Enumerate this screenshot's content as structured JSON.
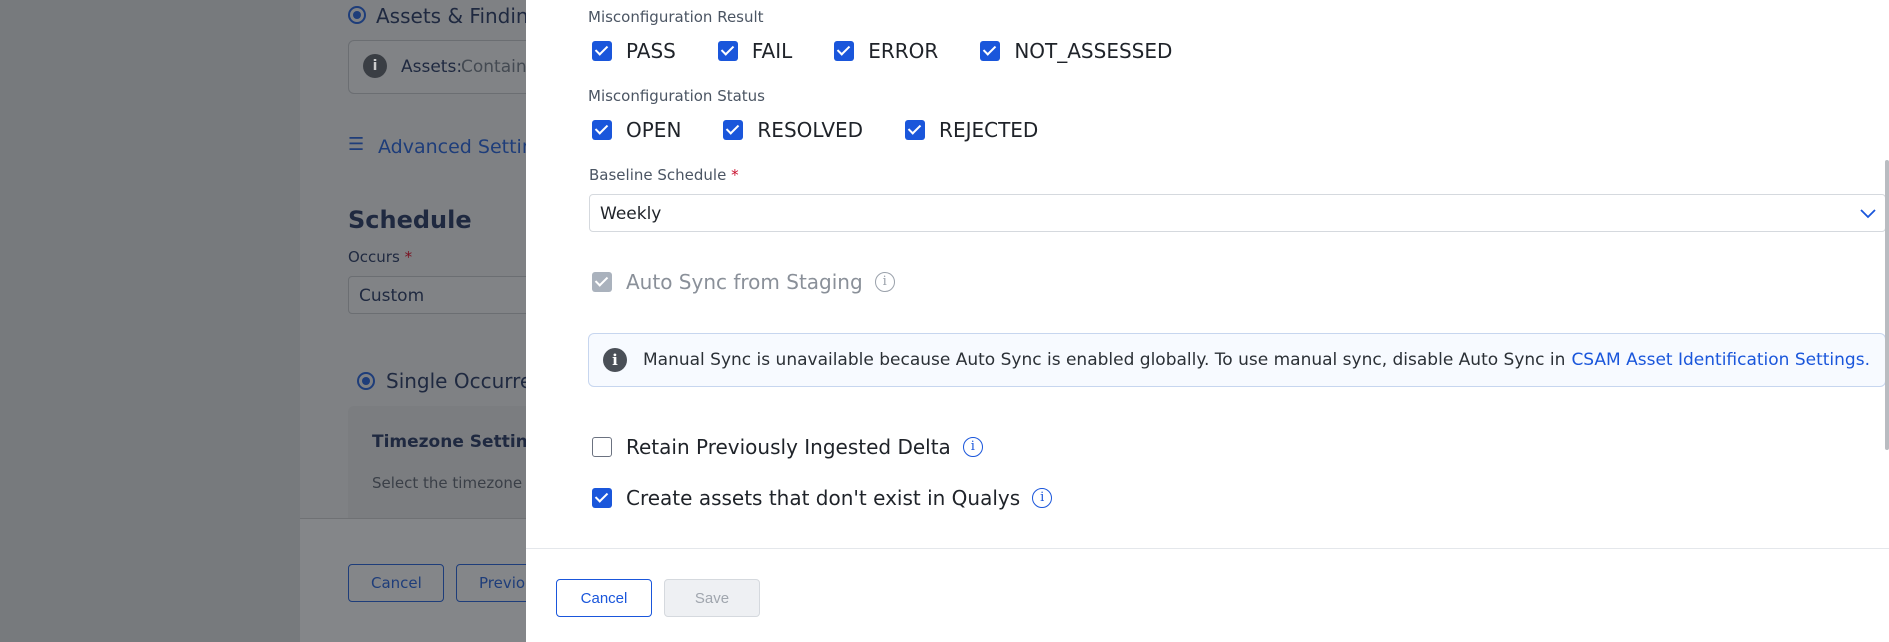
{
  "background": {
    "scope_radio_label": "Assets & Findings",
    "scope_info_label": "Assets:",
    "scope_info_value": "Containers",
    "advanced_settings_label": "Advanced Settings",
    "schedule_title": "Schedule",
    "occurs_label": "Occurs",
    "occurs_value": "Custom",
    "single_occurrence_label": "Single Occurrence",
    "timezone_title": "Timezone Settings",
    "timezone_hint": "Select the timezone to",
    "cancel_label": "Cancel",
    "previous_label": "Previous"
  },
  "drawer": {
    "misconfig_result": {
      "label": "Misconfiguration Result",
      "options": [
        {
          "label": "PASS",
          "checked": true
        },
        {
          "label": "FAIL",
          "checked": true
        },
        {
          "label": "ERROR",
          "checked": true
        },
        {
          "label": "NOT_ASSESSED",
          "checked": true
        }
      ]
    },
    "misconfig_status": {
      "label": "Misconfiguration Status",
      "options": [
        {
          "label": "OPEN",
          "checked": true
        },
        {
          "label": "RESOLVED",
          "checked": true
        },
        {
          "label": "REJECTED",
          "checked": true
        }
      ]
    },
    "baseline_schedule": {
      "label": "Baseline Schedule",
      "required_mark": "*",
      "value": "Weekly"
    },
    "auto_sync": {
      "label": "Auto Sync from Staging",
      "checked": true,
      "disabled": true
    },
    "banner": {
      "text": "Manual Sync is unavailable because Auto Sync is enabled globally. To use manual sync, disable Auto Sync in",
      "link": "CSAM Asset Identification Settings."
    },
    "retain_delta": {
      "label": "Retain Previously Ingested Delta",
      "checked": false
    },
    "create_assets": {
      "label": "Create assets that don't exist in Qualys",
      "checked": true
    },
    "footer": {
      "cancel_label": "Cancel",
      "save_label": "Save"
    }
  },
  "colors": {
    "accent": "#1a56db",
    "required": "#c8102e",
    "overlay": "#757779"
  },
  "icons": [
    "info-icon",
    "chevron-down-icon",
    "sliders-icon",
    "check-icon"
  ]
}
